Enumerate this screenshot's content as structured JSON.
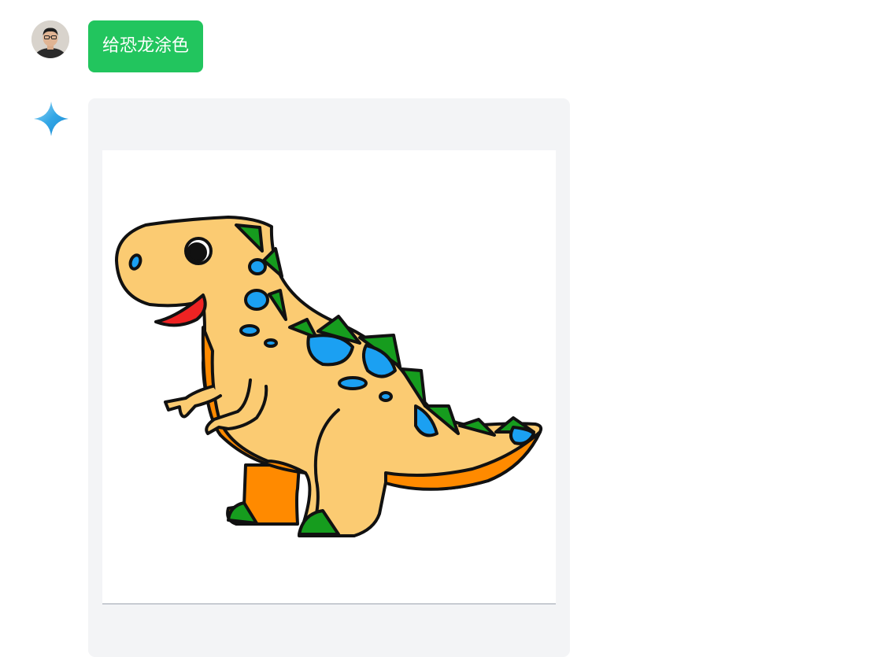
{
  "user": {
    "message": "给恐龙涂色"
  },
  "icons": {
    "user_avatar": "user-avatar-photo",
    "assistant": "sparkle-icon"
  },
  "colors": {
    "user_bubble": "#22c55e",
    "assistant_bubble": "#f3f4f6",
    "dino_body": "#fbcb72",
    "dino_belly": "#ff8a00",
    "dino_spikes": "#169c1e",
    "dino_spots": "#1ba0f2",
    "dino_mouth": "#ef2323"
  }
}
